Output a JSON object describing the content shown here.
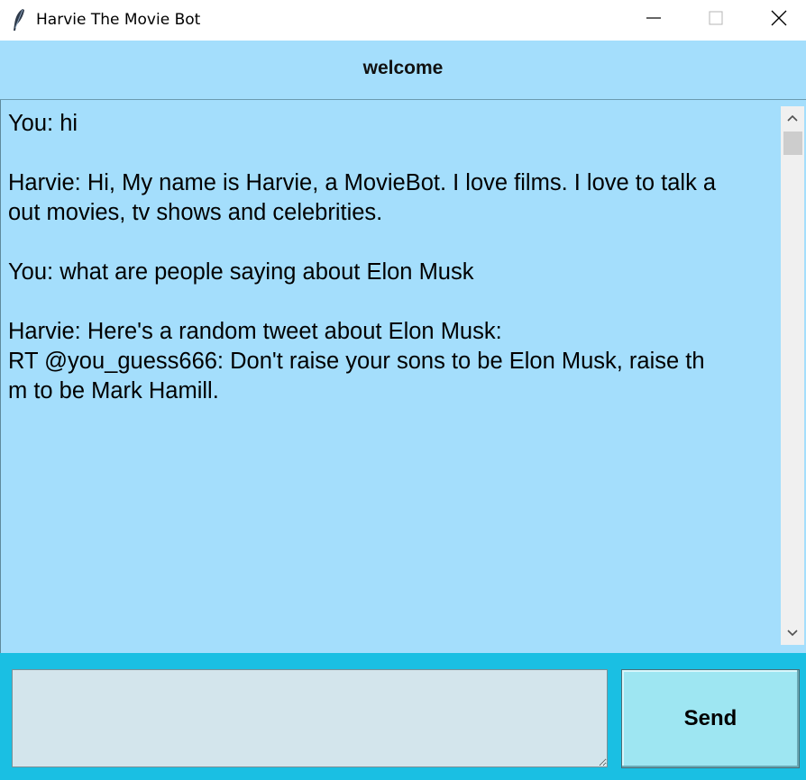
{
  "window": {
    "title": "Harvie The Movie Bot",
    "controls": [
      "minimize",
      "maximize",
      "close"
    ]
  },
  "header": {
    "title": "welcome"
  },
  "chat": {
    "messages": [
      "You: hi",
      "Harvie: Hi, My name is Harvie, a MovieBot. I love films. I love to talk a\nout movies, tv shows and celebrities.",
      "You: what are people saying about Elon Musk",
      "Harvie: Here's a random tweet about Elon Musk:\nRT @you_guess666: Don't raise your sons to be Elon Musk, raise th\nm to be Mark Hamill."
    ]
  },
  "input": {
    "value": "",
    "placeholder": ""
  },
  "send_button": {
    "label": "Send"
  },
  "colors": {
    "chat_background": "#a4defc",
    "bottom_bar": "#1abfe3",
    "input_background": "#d3e5ec",
    "send_button": "#9ee6f2"
  },
  "icons": {
    "app": "feather-icon",
    "minimize": "minimize-icon",
    "maximize": "maximize-icon",
    "close": "close-icon",
    "scroll_up": "chevron-up-icon",
    "scroll_down": "chevron-down-icon"
  }
}
